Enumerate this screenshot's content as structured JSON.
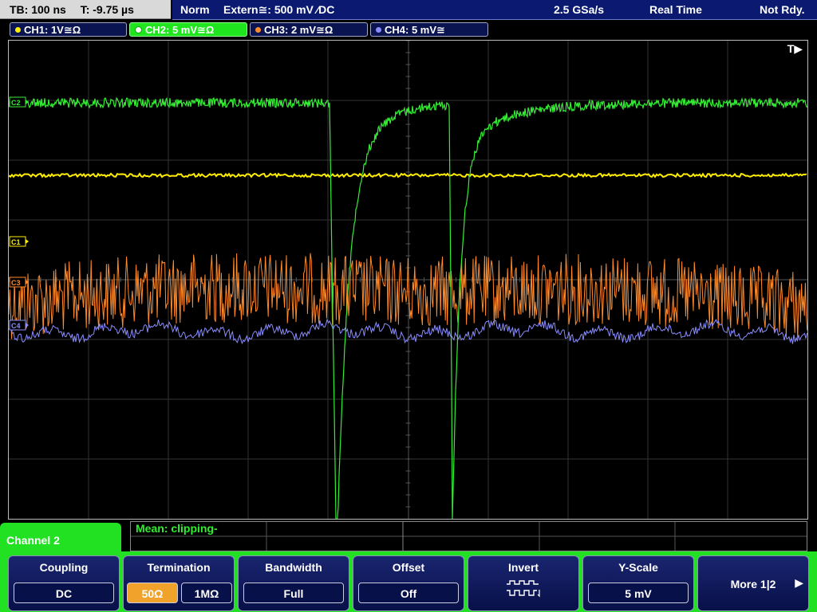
{
  "topbar": {
    "timebase": "TB: 100 ns",
    "trigger_time": "T: -9.75 µs",
    "trigger_mode": "Norm",
    "trigger_source": "Extern≅: 500 mV ⁄DC",
    "sample_rate": "2.5 GSa/s",
    "acq_mode": "Real Time",
    "status": "Not Rdy."
  },
  "channels": [
    {
      "label": "CH1: 1V≅Ω",
      "color": "#ffee00",
      "active": false
    },
    {
      "label": "CH2: 5 mV≅Ω",
      "color": "#33ee33",
      "active": true
    },
    {
      "label": "CH3: 2 mV≅Ω",
      "color": "#ff8a2a",
      "active": false
    },
    {
      "label": "CH4: 5 mV≅",
      "color": "#8a8cff",
      "active": false
    }
  ],
  "screen": {
    "trigger_marker": "T▶",
    "markers": [
      {
        "text": "C2",
        "color": "#33ee33"
      },
      {
        "text": "C1",
        "color": "#ffee00"
      },
      {
        "text": "C3",
        "color": "#ff8a2a"
      },
      {
        "text": "C4",
        "color": "#8a8cff"
      }
    ]
  },
  "measurement": {
    "text": "Mean: clipping-"
  },
  "menu": {
    "title": "Channel 2",
    "softkeys": {
      "coupling": {
        "title": "Coupling",
        "value": "DC"
      },
      "termination": {
        "title": "Termination",
        "options": [
          "50Ω",
          "1MΩ"
        ],
        "selected": "50Ω"
      },
      "bandwidth": {
        "title": "Bandwidth",
        "value": "Full"
      },
      "offset": {
        "title": "Offset",
        "value": "Off"
      },
      "invert": {
        "title": "Invert",
        "icon": "invert-waveform-icon"
      },
      "yscale": {
        "title": "Y-Scale",
        "value": "5 mV"
      },
      "more": {
        "label": "More 1|2",
        "icon": "arrow-right-icon"
      }
    }
  }
}
